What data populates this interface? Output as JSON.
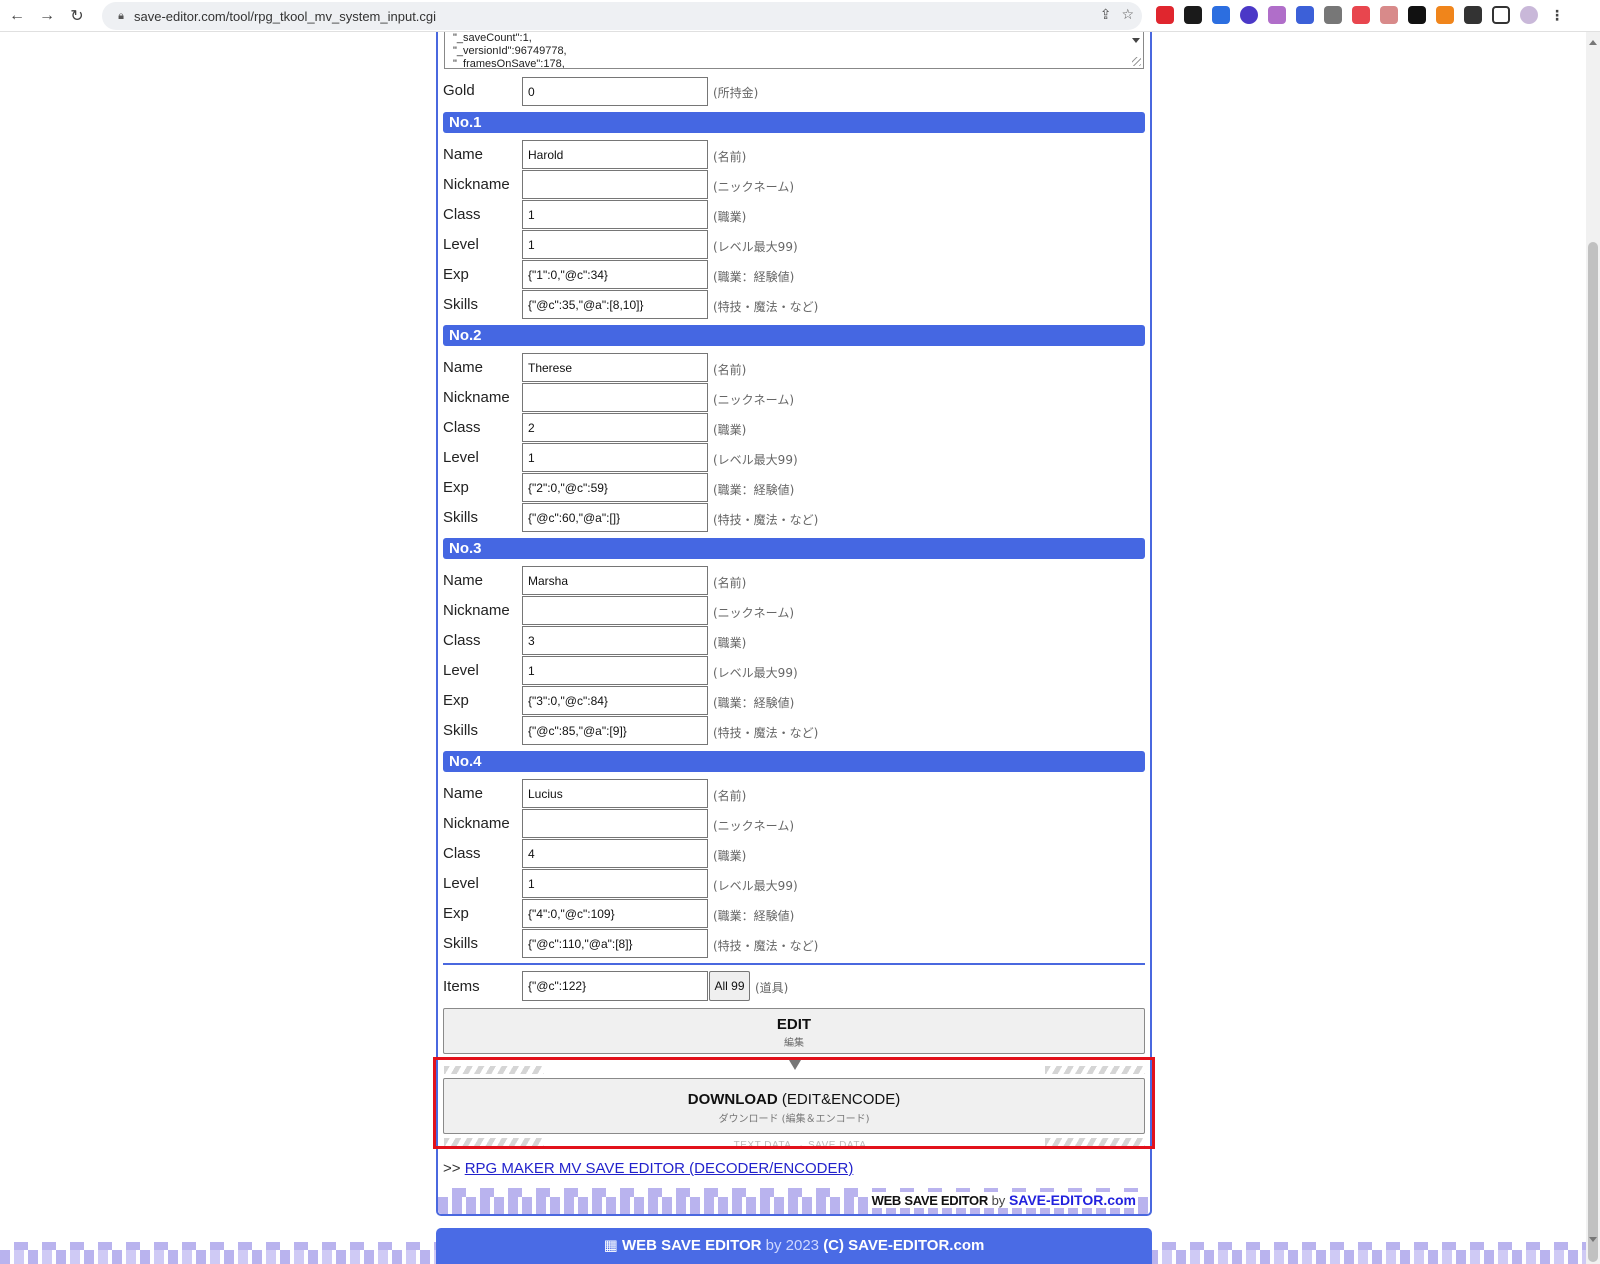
{
  "browser": {
    "url": "save-editor.com/tool/rpg_tkool_mv_system_input.cgi"
  },
  "textarea_lines": [
    "\"_saveCount\":1,",
    "\"_versionId\":96749778,",
    "\"_framesOnSave\":178,"
  ],
  "gold": {
    "label": "Gold",
    "value": "0",
    "note": "(所持金)"
  },
  "field_labels": {
    "name": "Name",
    "nickname": "Nickname",
    "class": "Class",
    "level": "Level",
    "exp": "Exp",
    "skills": "Skills"
  },
  "field_notes": {
    "name": "(名前)",
    "nickname": "(ニックネーム)",
    "class": "(職業)",
    "level": "(レベル最大99)",
    "exp": "(職業：経験値)",
    "skills": "(特技・魔法・など)"
  },
  "actors": [
    {
      "header": "No.1",
      "name": "Harold",
      "nickname": "",
      "class": "1",
      "level": "1",
      "exp": "{\"1\":0,\"@c\":34}",
      "skills": "{\"@c\":35,\"@a\":[8,10]}"
    },
    {
      "header": "No.2",
      "name": "Therese",
      "nickname": "",
      "class": "2",
      "level": "1",
      "exp": "{\"2\":0,\"@c\":59}",
      "skills": "{\"@c\":60,\"@a\":[]}"
    },
    {
      "header": "No.3",
      "name": "Marsha",
      "nickname": "",
      "class": "3",
      "level": "1",
      "exp": "{\"3\":0,\"@c\":84}",
      "skills": "{\"@c\":85,\"@a\":[9]}"
    },
    {
      "header": "No.4",
      "name": "Lucius",
      "nickname": "",
      "class": "4",
      "level": "1",
      "exp": "{\"4\":0,\"@c\":109}",
      "skills": "{\"@c\":110,\"@a\":[8]}"
    }
  ],
  "items": {
    "label": "Items",
    "value": "{\"@c\":122}",
    "all_button": "All 99",
    "note": "(道具)"
  },
  "edit_button": {
    "label": "EDIT",
    "sub": "編集"
  },
  "download_button": {
    "label_bold": "DOWNLOAD",
    "label_rest": " (EDIT&ENCODE)",
    "sub": "ダウンロード (編集＆エンコード)",
    "caption": "TEXT DATA → SAVE DATA"
  },
  "link": {
    "prefix": ">> ",
    "text": "RPG MAKER MV SAVE EDITOR (DECODER/ENCODER)"
  },
  "panel_brand": {
    "a": "WEB SAVE EDITOR",
    "by": " by ",
    "b": "SAVE-EDITOR.com"
  },
  "footer": {
    "brand": "WEB SAVE EDITOR",
    "by": " by 2023 ",
    "copy": "(C) SAVE-EDITOR.com"
  },
  "colors": {
    "accent": "#4567e2",
    "highlight": "#e2111b",
    "link": "#2222cc"
  }
}
